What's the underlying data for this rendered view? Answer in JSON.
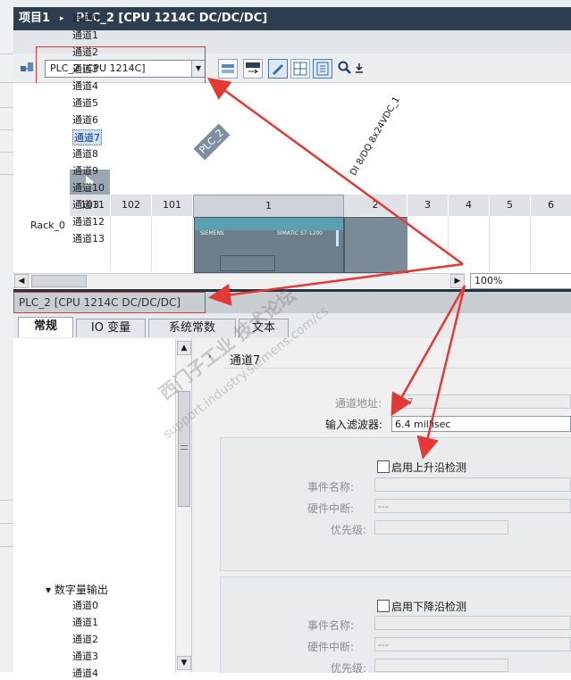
{
  "title_bar": {
    "project": "项目1",
    "separator": "▸",
    "device": "PLC_2 [CPU 1214C DC/DC/DC]"
  },
  "toolbar": {
    "device_select": "PLC_2 [CPU 1214C]"
  },
  "canvas": {
    "plc_label": "PLC_2",
    "module_label": "DI 8/DQ 8x24VDC_1",
    "rack_name": "Rack_0",
    "slots": [
      "103",
      "102",
      "101",
      "1",
      "2",
      "3",
      "4",
      "5",
      "6"
    ],
    "cpu_brand": "SIEMENS",
    "cpu_model": "SIMATIC S7-1200"
  },
  "zoom": "100%",
  "inspector": {
    "title": "PLC_2 [CPU 1214C DC/DC/DC]",
    "tabs": [
      "常规",
      "IO 变量",
      "系统常数",
      "文本"
    ],
    "tree_input_channels": [
      "通道0",
      "通道1",
      "通道2",
      "通道3",
      "通道4",
      "通道5",
      "通道6",
      "通道7",
      "通道8",
      "通道9",
      "通道10",
      "通道11",
      "通道12",
      "通道13"
    ],
    "tree_output_group": "数字量输出",
    "tree_output_channels": [
      "通道0",
      "通道1",
      "通道2",
      "通道3",
      "通道4"
    ],
    "section_title": "通道7",
    "channel_address_label": "通道地址:",
    "channel_address_value": "I0.7",
    "input_filter_label": "输入滤波器:",
    "input_filter_value": "6.4 millisec",
    "rising": {
      "checkbox_label": "启用上升沿检测",
      "event_label": "事件名称:",
      "hw_interrupt_label": "硬件中断:",
      "hw_interrupt_value": "---",
      "priority_label": "优先级:"
    },
    "falling": {
      "checkbox_label": "启用下降沿检测",
      "event_label": "事件名称:",
      "hw_interrupt_label": "硬件中断:",
      "hw_interrupt_value": "---",
      "priority_label": "优先级:"
    }
  },
  "watermark": {
    "line1": "西门子工业 技术论坛",
    "line2": "support.industry.siemens.com/cs"
  },
  "colors": {
    "title_bar": "#2c3e50",
    "accent_red": "#e53935",
    "selection": "#cfe0f5"
  }
}
